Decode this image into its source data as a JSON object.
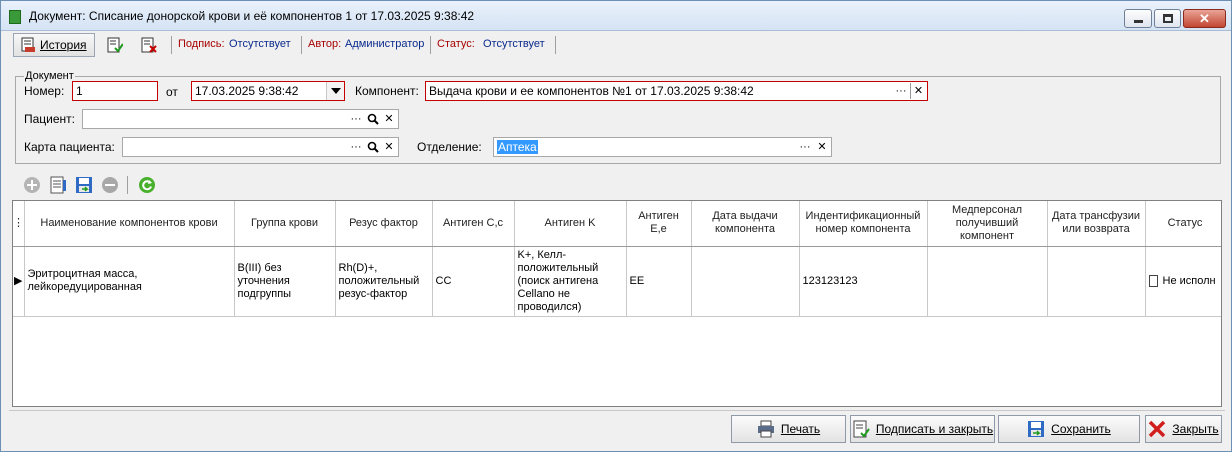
{
  "window": {
    "title": "Документ: Списание донорской крови и её компонентов 1 от 17.03.2025 9:38:42",
    "controls": {
      "minimize": "minimize-icon",
      "maximize": "maximize-icon",
      "close": "close-icon"
    }
  },
  "toolbar": {
    "history_label": "История",
    "signature_label": "Подпись:",
    "signature_value": "Отсутствует",
    "author_label": "Автор:",
    "author_value": "Администратор",
    "status_label": "Статус:",
    "status_value": "Отсутствует"
  },
  "document": {
    "group_label": "Документ",
    "number_label": "Номер:",
    "number_value": "1",
    "date_label": "от",
    "date_value": "17.03.2025 9:38:42",
    "component_label": "Компонент:",
    "component_value": "Выдача крови и ее компонентов №1 от 17.03.2025 9:38:42",
    "patient_label": "Пациент:",
    "patient_value": "",
    "card_label": "Карта пациента:",
    "card_value": "",
    "department_label": "Отделение:",
    "department_value": "Аптека"
  },
  "grid": {
    "columns": [
      "Наименование компонентов крови",
      "Группа крови",
      "Резус фактор",
      "Антиген C,c",
      "Антиген K",
      "Антиген E,e",
      "Дата выдачи компонента",
      "Индентификационный номер компонента",
      "Медперсонал получивший компонент",
      "Дата трансфузии или возврата",
      "Статус"
    ],
    "rows": [
      {
        "name": "Эритроцитная масса, лейкоредуцированная",
        "group": "B(III) без уточнения подгруппы",
        "rh": "Rh(D)+, положительный резус-фактор",
        "antigen_c": "CC",
        "antigen_k": "K+, Келл-положительный (поиск антигена Cellano не проводился)",
        "antigen_e": "EE",
        "issue_date": "",
        "id_number": "123123123",
        "staff": "",
        "transfusion_date": "",
        "status": "Не исполн"
      }
    ]
  },
  "footer": {
    "print_label": "Печать",
    "sign_close_label": "Подписать и закрыть",
    "save_label": "Сохранить",
    "close_label": "Закрыть"
  },
  "colors": {
    "required_border": "#c40000",
    "label_red": "#a80000",
    "value_blue": "#0a2a8c",
    "selection": "#3399ff"
  }
}
